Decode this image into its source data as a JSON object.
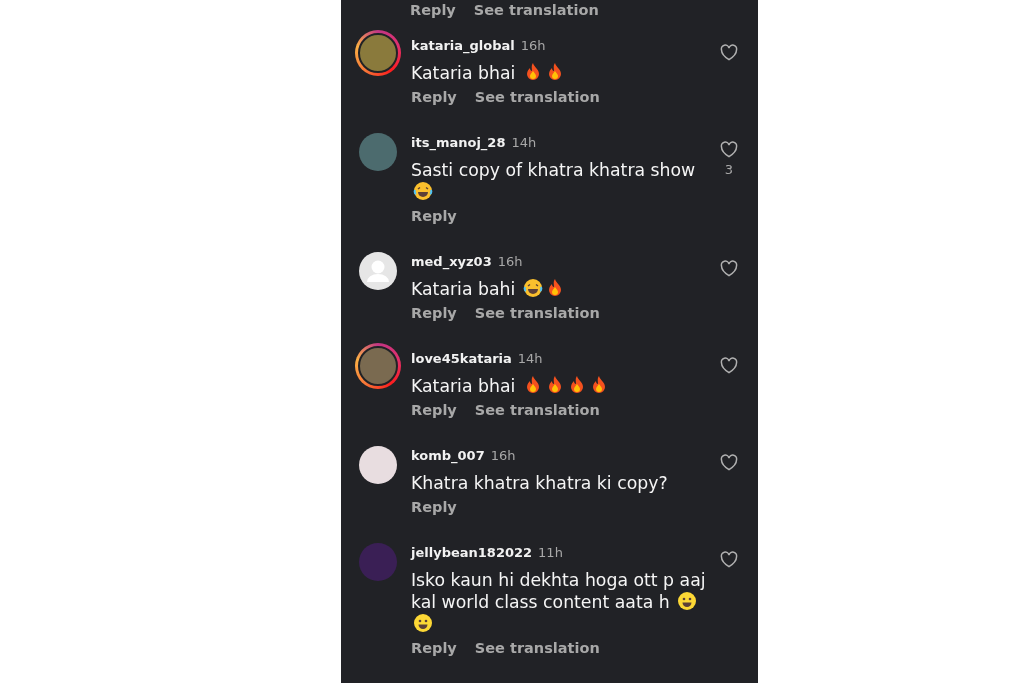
{
  "partial_comment": {
    "actions": [
      "Reply",
      "See translation"
    ]
  },
  "comments": [
    {
      "username": "kataria_global",
      "time": "16h",
      "avatar": {
        "kind": "photo",
        "story_ring": true
      },
      "text": "Kataria bhai",
      "emoji": [
        {
          "kind": "fire"
        },
        {
          "kind": "fire"
        }
      ],
      "actions": [
        "Reply",
        "See translation"
      ]
    },
    {
      "username": "its_manoj_28",
      "time": "14h",
      "avatar": {
        "kind": "photo",
        "story_ring": false
      },
      "text": "Sasti copy of khatra khatra show",
      "emoji": [
        {
          "kind": "laugh"
        }
      ],
      "likes": "3",
      "actions": [
        "Reply"
      ]
    },
    {
      "username": "med_xyz03",
      "time": "16h",
      "avatar": {
        "kind": "default",
        "story_ring": false
      },
      "text": "Kataria bahi",
      "emoji": [
        {
          "kind": "laugh"
        },
        {
          "kind": "fire"
        }
      ],
      "actions": [
        "Reply",
        "See translation"
      ]
    },
    {
      "username": "love45kataria",
      "time": "14h",
      "avatar": {
        "kind": "photo",
        "story_ring": true
      },
      "text": "Kataria bhai",
      "emoji": [
        {
          "kind": "fire"
        },
        {
          "kind": "fire"
        },
        {
          "kind": "fire"
        },
        {
          "kind": "fire"
        }
      ],
      "actions": [
        "Reply",
        "See translation"
      ]
    },
    {
      "username": "komb_007",
      "time": "16h",
      "avatar": {
        "kind": "photo",
        "story_ring": false
      },
      "text": "Khatra khatra khatra ki copy?",
      "actions": [
        "Reply"
      ]
    },
    {
      "username": "jellybean182022",
      "time": "11h",
      "avatar": {
        "kind": "photo",
        "story_ring": false
      },
      "text": "Isko kaun hi dekhta hoga ott p aaj kal world class content aata h",
      "emoji": [
        {
          "kind": "smile"
        },
        {
          "kind": "smile"
        }
      ],
      "actions": [
        "Reply",
        "See translation"
      ]
    }
  ]
}
